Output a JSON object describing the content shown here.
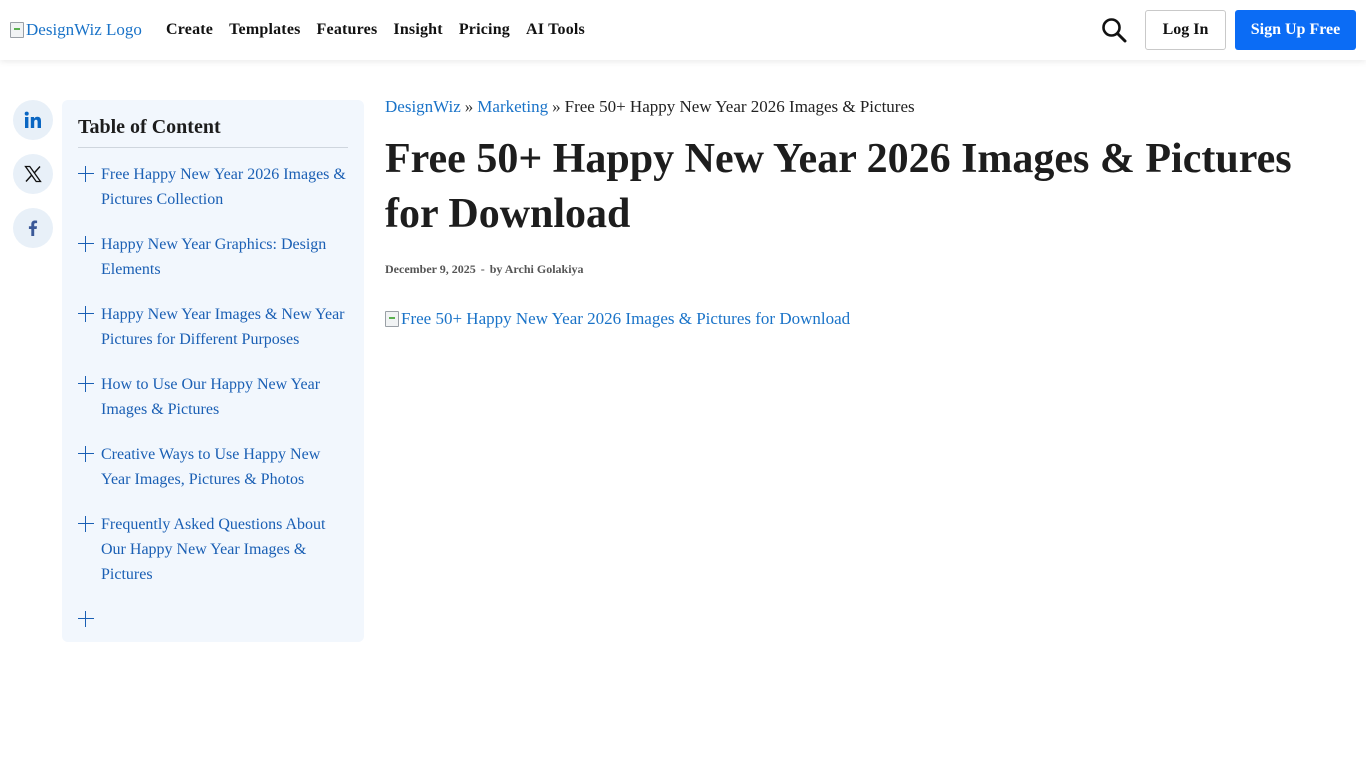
{
  "header": {
    "logo_alt": "DesignWiz Logo",
    "nav": [
      "Create",
      "Templates",
      "Features",
      "Insight",
      "Pricing",
      "AI Tools"
    ],
    "search_icon": "search-icon",
    "login_label": "Log In",
    "signup_label": "Sign Up Free"
  },
  "share": {
    "icons": [
      "linkedin-icon",
      "x-icon",
      "facebook-icon"
    ]
  },
  "toc": {
    "title": "Table of Content",
    "items": [
      "Free Happy New Year 2026 Images & Pictures Collection",
      "Happy New Year Graphics: Design Elements",
      "Happy New Year Images & New Year Pictures for Different Purposes",
      "How to Use Our Happy New Year Images & Pictures",
      "Creative Ways to Use Happy New Year Images, Pictures & Photos",
      "Frequently Asked Questions About Our Happy New Year Images & Pictures"
    ]
  },
  "breadcrumb": {
    "home": "DesignWiz",
    "separator": "»",
    "category": "Marketing",
    "current": "Free 50+ Happy New Year 2026 Images & Pictures"
  },
  "article": {
    "title": "Free 50+ Happy New Year 2026 Images & Pictures for Download",
    "date": "December 9, 2025",
    "meta_separator": "-",
    "author": "by Archi Golakiya",
    "hero_alt": "Free 50+ Happy New Year 2026 Images & Pictures for Download"
  },
  "colors": {
    "accent": "#0b6cf5",
    "link": "#1a73c8",
    "toc_background": "#f2f7fd"
  }
}
